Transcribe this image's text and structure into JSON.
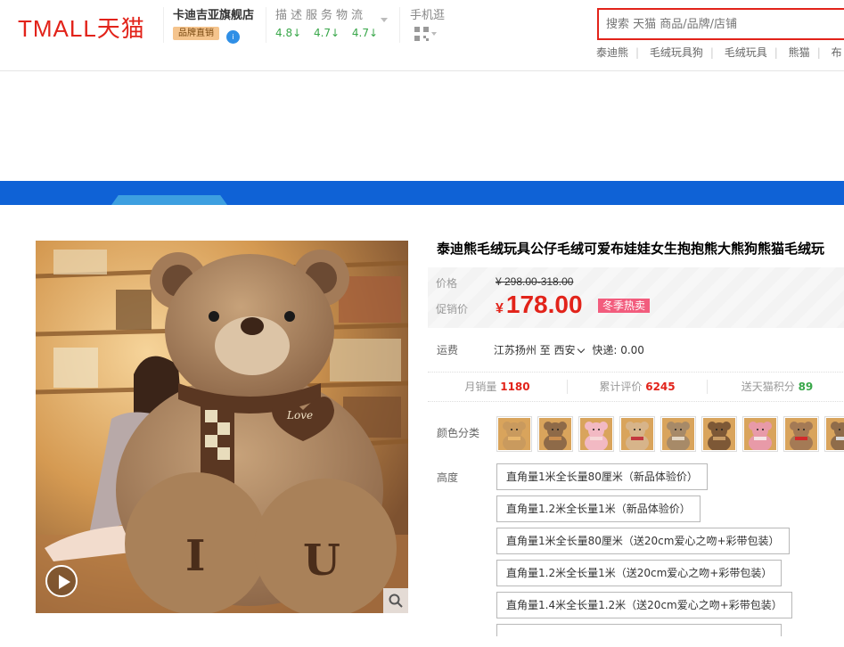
{
  "brand": {
    "logo_text": "TMALL天猫"
  },
  "shop": {
    "name": "卡迪吉亚旗舰店",
    "badge": "品牌直销",
    "info_badge": "i"
  },
  "ratings": {
    "labels": "描述服务物流",
    "values": "4.8↓ 4.7↓ 4.7↓"
  },
  "mobile": {
    "label": "手机逛"
  },
  "search": {
    "placeholder": "搜索 天猫 商品/品牌/店铺",
    "hot_words": [
      "泰迪熊",
      "毛绒玩具狗",
      "毛绒玩具",
      "熊猫",
      "布"
    ]
  },
  "product": {
    "title": "泰迪熊毛绒玩具公仔毛绒可爱布娃娃女生抱抱熊大熊狗熊猫毛绒玩",
    "price_label": "价格",
    "original_price": "¥ 298.00-318.00",
    "promo_label": "促销价",
    "promo_currency": "¥",
    "promo_price": "178.00",
    "promo_tag": "冬季热卖",
    "shipping": {
      "label": "运费",
      "from": "江苏扬州",
      "to_word": "至",
      "to": "西安",
      "express": "快递: 0.00"
    },
    "stats": [
      {
        "label": "月销量",
        "value": "1180",
        "color": "#e2231a"
      },
      {
        "label": "累计评价",
        "value": "6245",
        "color": "#e2231a"
      },
      {
        "label": "送天猫积分",
        "value": "89",
        "color": "#39a74a"
      }
    ],
    "color_label": "颜色分类",
    "swatches": [
      {
        "color": "#c99a5e",
        "accent": "#e8b66c"
      },
      {
        "color": "#8e6a48",
        "accent": "#c98d4f"
      },
      {
        "color": "#f2b9c3",
        "accent": "#f6d8d8"
      },
      {
        "color": "#d7b48a",
        "accent": "#c3373f"
      },
      {
        "color": "#a78a68",
        "accent": "#e4d7c4"
      },
      {
        "color": "#7d5836",
        "accent": "#c79b65"
      },
      {
        "color": "#e89aa8",
        "accent": "#f5e5e5"
      },
      {
        "color": "#a47a55",
        "accent": "#d12a2a"
      },
      {
        "color": "#8f6c4a",
        "accent": "#dcdcdc"
      }
    ],
    "height_label": "高度",
    "height_options": [
      "直角量1米全长量80厘米（新品体验价）",
      "直角量1.2米全长量1米（新品体验价）",
      "直角量1米全长量80厘米（送20cm爱心之吻+彩带包装）",
      "直角量1.2米全长量1米（送20cm爱心之吻+彩带包装）",
      "直角量1.4米全长量1.2米（送20cm爱心之吻+彩带包装）",
      ""
    ]
  },
  "image": {
    "heart_text": "Love",
    "letters": [
      "I",
      "U"
    ]
  },
  "colors": {
    "brand_red": "#e2231a",
    "banner_blue": "#0f62d6",
    "rating_green": "#39a74a"
  }
}
